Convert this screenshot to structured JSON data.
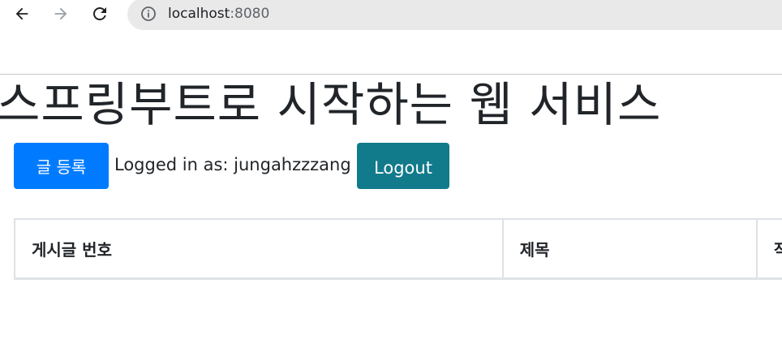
{
  "browser": {
    "url_host": "localhost",
    "url_port": ":8080"
  },
  "page": {
    "title": "스프링부트로 시작하는 웹 서비스"
  },
  "toolbar": {
    "register_label": "글 등록",
    "logged_in_prefix": "Logged in as: ",
    "username": "jungahzzzang",
    "logout_label": "Logout"
  },
  "table": {
    "headers": [
      "게시글 번호",
      "제목",
      "작"
    ]
  },
  "colors": {
    "primary": "#007bff",
    "info": "#117a8b",
    "text": "#212529",
    "border": "#dee2e6"
  }
}
